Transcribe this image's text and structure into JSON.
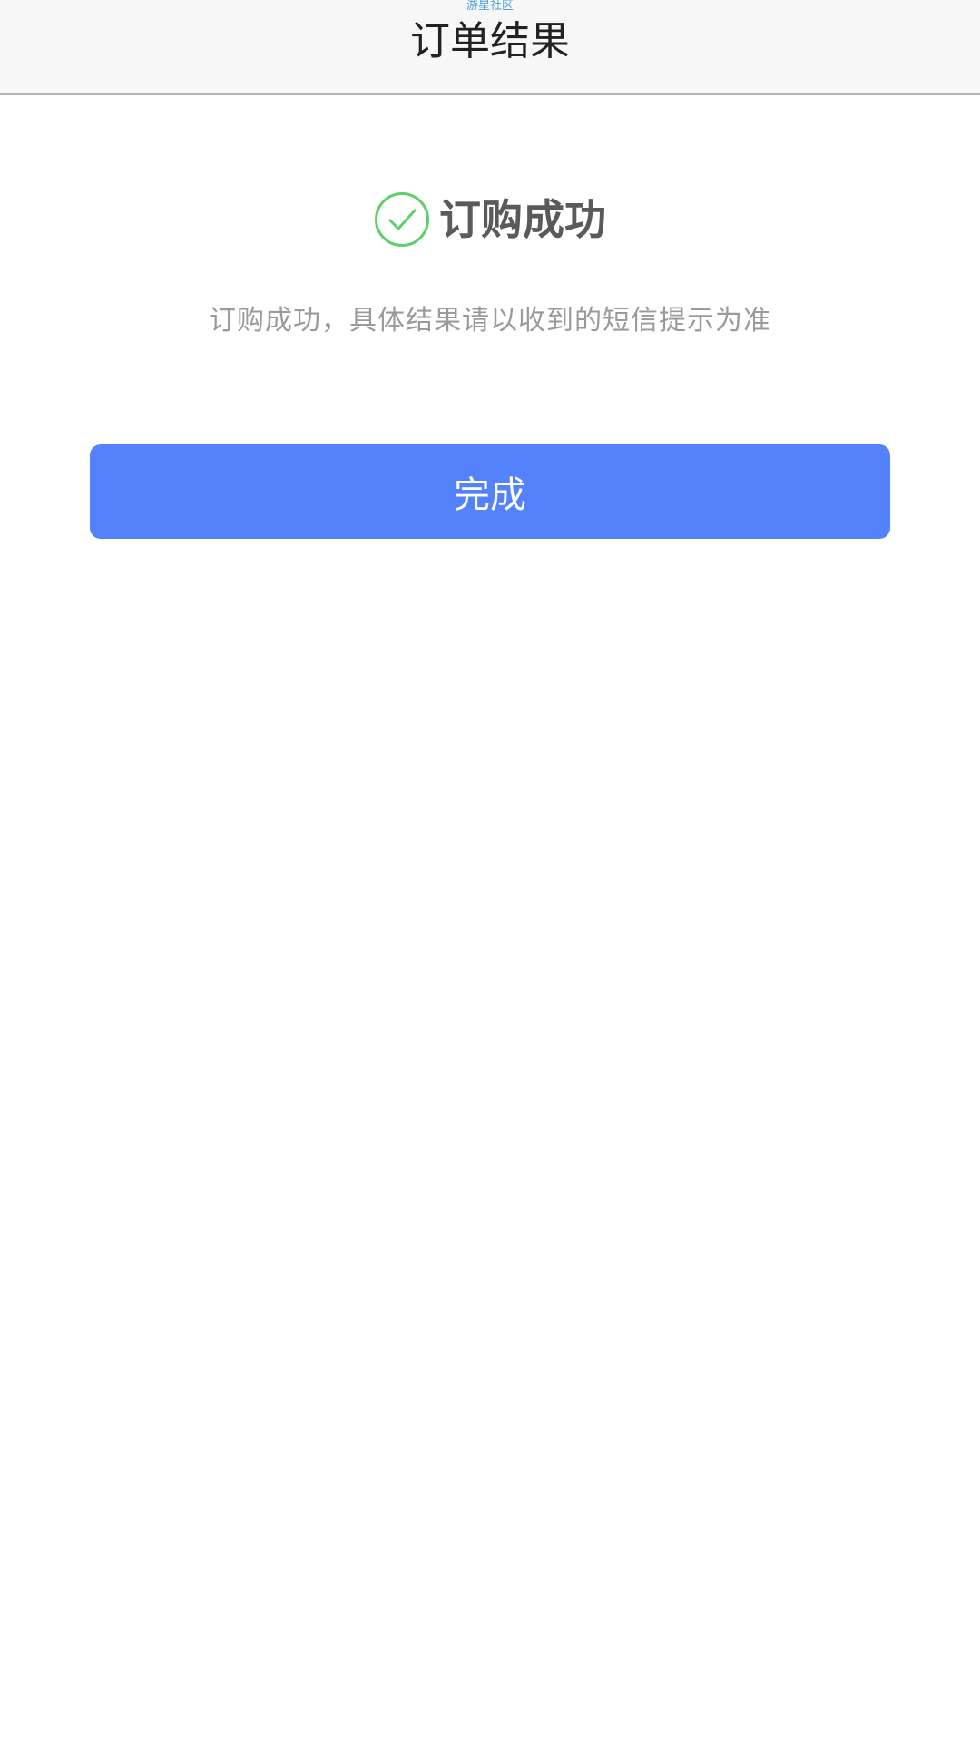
{
  "header": {
    "watermark": "游星社区",
    "title": "订单结果"
  },
  "result": {
    "icon": "check-circle-icon",
    "icon_color": "#5fcf6b",
    "title": "订购成功",
    "description": "订购成功，具体结果请以收到的短信提示为准"
  },
  "actions": {
    "done_label": "完成",
    "done_color": "#5482fd"
  }
}
